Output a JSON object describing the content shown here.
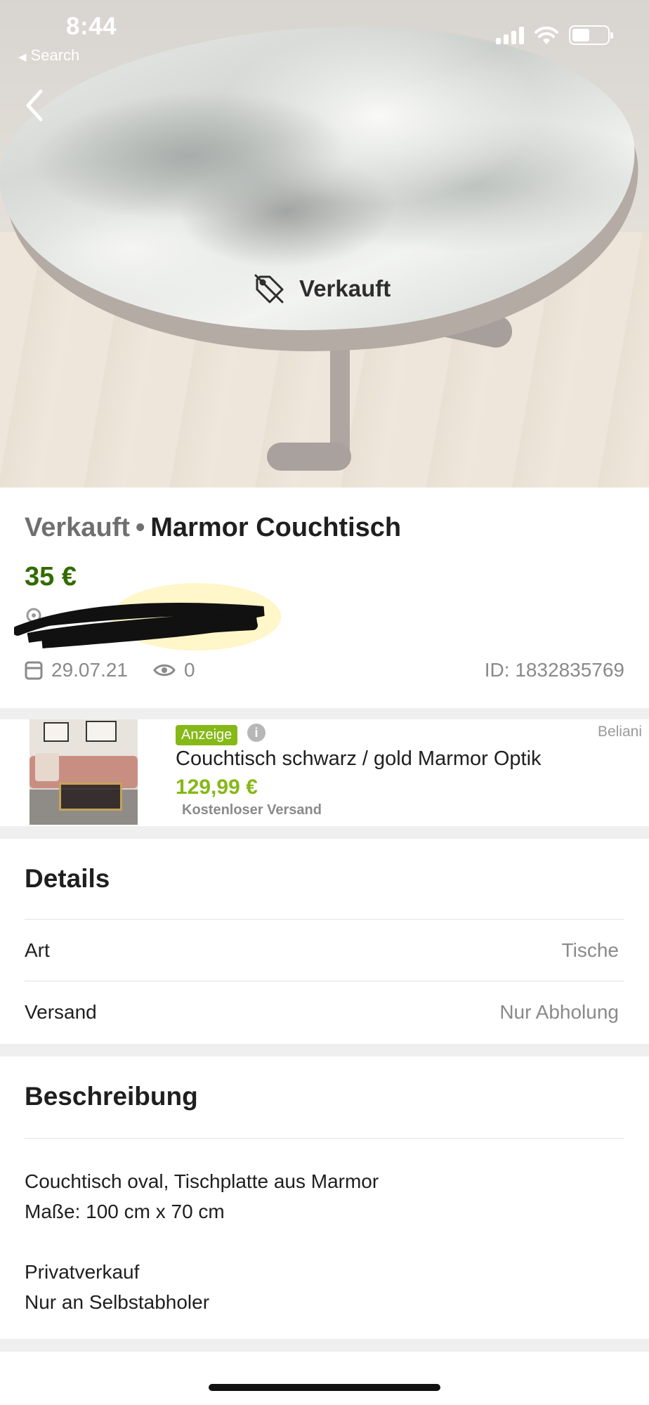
{
  "status_bar": {
    "time": "8:44",
    "back_app": "Search"
  },
  "hero": {
    "sold_label": "Verkauft"
  },
  "listing": {
    "status": "Verkauft",
    "separator": "•",
    "title": "Marmor Couchtisch",
    "price": "35 €",
    "date": "29.07.21",
    "views": "0",
    "id_text": "ID: 1832835769"
  },
  "ad": {
    "badge": "Anzeige",
    "info": "i",
    "brand": "Beliani",
    "title": "Couchtisch schwarz / gold Marmor Optik",
    "price": "129,99 €",
    "shipping": "Kostenloser Versand"
  },
  "details": {
    "heading": "Details",
    "rows": [
      {
        "key": "Art",
        "value": "Tische"
      },
      {
        "key": "Versand",
        "value": "Nur Abholung"
      }
    ]
  },
  "description": {
    "heading": "Beschreibung",
    "lines": [
      "Couchtisch oval, Tischplatte aus Marmor",
      "Maße: 100 cm x 70 cm",
      "",
      "Privatverkauf",
      "Nur an Selbstabholer"
    ]
  },
  "colors": {
    "price_green": "#326b00",
    "ad_green": "#86b817",
    "muted_text": "#8a8a8a",
    "section_bg": "#efefef"
  },
  "icons": [
    "chevron-left-icon",
    "sold-tag-icon",
    "location-pin-icon",
    "calendar-icon",
    "eye-icon",
    "info-icon",
    "signal-icon",
    "wifi-icon",
    "battery-icon"
  ]
}
